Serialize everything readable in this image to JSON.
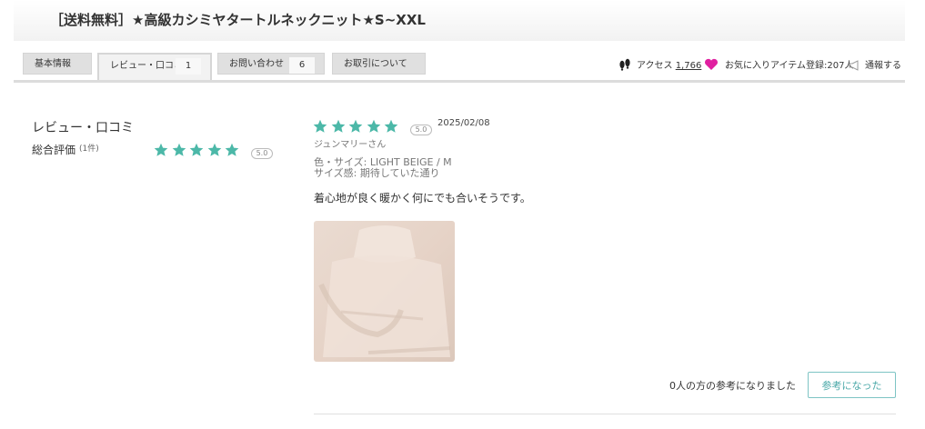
{
  "product": {
    "title": "［送料無料］★高級カシミヤタートルネックニット★S~XXL"
  },
  "tabs": [
    {
      "label": "基本情報",
      "count": null
    },
    {
      "label": "レビュー・口コミ",
      "count": "1"
    },
    {
      "label": "お問い合わせ",
      "count": "6"
    },
    {
      "label": "お取引について",
      "count": null
    }
  ],
  "stats": {
    "access_label": "アクセス",
    "access_count": "1,766",
    "favorite_text": "お気に入りアイテム登録:207人",
    "report_label": "通報する"
  },
  "reviews_summary": {
    "heading": "レビュー・口コミ",
    "overall_label": "総合評価",
    "count_text": "(1件)",
    "rating": 5,
    "rating_text": "5.0"
  },
  "review": {
    "rating": 5,
    "rating_text": "5.0",
    "date": "2025/02/08",
    "user": "ジュンマリーさん",
    "color_size": "色・サイズ: LIGHT BEIGE / M",
    "fit": "サイズ感: 期待していた通り",
    "body": "着心地が良く暖かく何にでも合いそうです。",
    "helpful_text": "0人の方の参考になりました",
    "helpful_button": "参考になった"
  },
  "colors": {
    "star": "#4cb8a8",
    "favorite_heart": "#e020a0",
    "accent": "#4aa8a8"
  }
}
